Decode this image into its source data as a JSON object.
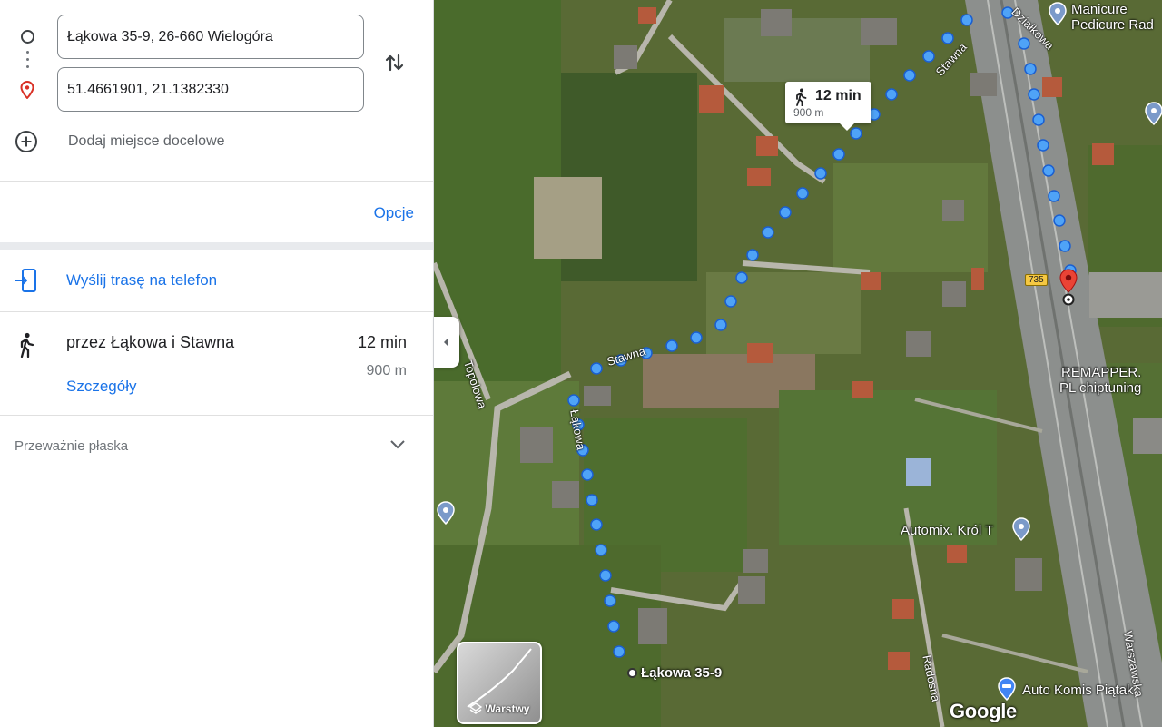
{
  "directions": {
    "origin_value": "Łąkowa 35-9, 26-660 Wielogóra",
    "destination_value": "51.4661901, 21.1382330",
    "add_destination_label": "Dodaj miejsce docelowe",
    "options_label": "Opcje",
    "send_to_phone_label": "Wyślij trasę na telefon"
  },
  "trip": {
    "via_label": "przez Łąkowa i Stawna",
    "duration": "12 min",
    "distance": "900 m",
    "details_label": "Szczegóły"
  },
  "elevation": {
    "label": "Przeważnie płaska"
  },
  "map": {
    "callout": {
      "duration": "12 min",
      "distance": "900 m"
    },
    "start_label": "Łąkowa 35-9",
    "layers_label": "Warstwy",
    "logo": "Google",
    "road_shield": "735",
    "road_labels": {
      "stawna_top": "Stawna",
      "stawna_mid": "Stawna",
      "dzialkowa": "Działkowa",
      "lakowa": "Łąkowa",
      "topolowa": "Topolowa",
      "radosna": "Radosna",
      "warszawska": "Warszawska"
    },
    "pois": {
      "manicure_line1": "Manicure",
      "manicure_line2": "Pedicure Rad",
      "remapper_line1": "REMAPPER.",
      "remapper_line2": "PL chiptuning",
      "automix": "Automix. Król T",
      "autokomis": "Auto Komis Piątak"
    },
    "colors": {
      "route": "#4285f4",
      "route_outline": "#1a5fd1",
      "destination_pin": "#ea4335",
      "link": "#1a73e8"
    }
  }
}
